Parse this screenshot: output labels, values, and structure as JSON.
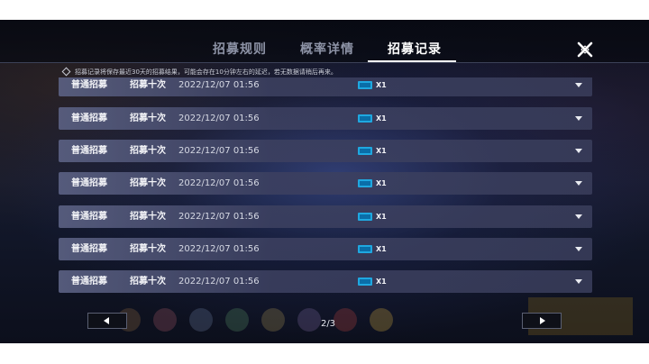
{
  "tabs": [
    {
      "label": "招募规则",
      "active": false
    },
    {
      "label": "概率详情",
      "active": false
    },
    {
      "label": "招募记录",
      "active": true
    }
  ],
  "notice": "招募记录将保存最近30天的招募结果，可能会存在10分钟左右的延迟，若无数据请稍后再来。",
  "records": [
    {
      "type": "普通招募",
      "count": "招募十次",
      "time": "2022/12/07 01:56",
      "quantity": "X1",
      "item_icon": "blue-ticket-icon"
    },
    {
      "type": "普通招募",
      "count": "招募十次",
      "time": "2022/12/07 01:56",
      "quantity": "X1",
      "item_icon": "blue-ticket-icon"
    },
    {
      "type": "普通招募",
      "count": "招募十次",
      "time": "2022/12/07 01:56",
      "quantity": "X1",
      "item_icon": "blue-ticket-icon"
    },
    {
      "type": "普通招募",
      "count": "招募十次",
      "time": "2022/12/07 01:56",
      "quantity": "X1",
      "item_icon": "blue-ticket-icon"
    },
    {
      "type": "普通招募",
      "count": "招募十次",
      "time": "2022/12/07 01:56",
      "quantity": "X1",
      "item_icon": "blue-ticket-icon"
    },
    {
      "type": "普通招募",
      "count": "招募十次",
      "time": "2022/12/07 01:56",
      "quantity": "X1",
      "item_icon": "blue-ticket-icon"
    },
    {
      "type": "普通招募",
      "count": "招募十次",
      "time": "2022/12/07 01:56",
      "quantity": "X1",
      "item_icon": "blue-ticket-icon"
    }
  ],
  "pagination": {
    "current": 2,
    "total": 3,
    "label": "2/3"
  },
  "colors": {
    "accent": "#ffffff",
    "row_bg": "#5a6082",
    "ticket_blue": "#1fa8e0"
  }
}
